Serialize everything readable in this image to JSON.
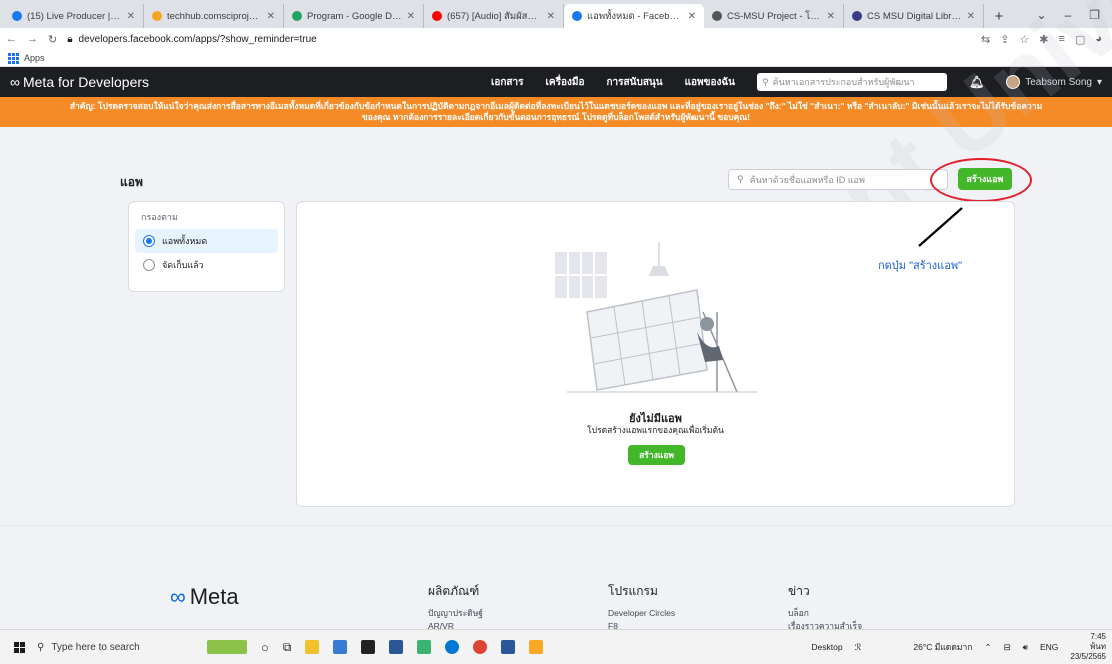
{
  "browser": {
    "tabs": [
      {
        "title": "(15) Live Producer | Facebook",
        "fav": "#1877f2",
        "active": false
      },
      {
        "title": "techhub.comsciproject.com / lo",
        "fav": "#f5a623",
        "active": false
      },
      {
        "title": "Program - Google Drive",
        "fav": "#1fa463",
        "active": false
      },
      {
        "title": "(657) [Audio] สัมผัสที่โลกสัมผ...",
        "fav": "#ff0000",
        "active": false
      },
      {
        "title": "แอพทั้งหมด - Facebook สำหรับผู้พั...",
        "fav": "#1877f2",
        "active": true
      },
      {
        "title": "CS-MSU Project - โปรเจ็คจบการศ...",
        "fav": "#555555",
        "active": false
      },
      {
        "title": "CS MSU Digital Library ระบบการจั...",
        "fav": "#3a3a8c",
        "active": false
      }
    ],
    "new_tab": "+",
    "url": "developers.facebook.com/apps/?show_reminder=true",
    "bookmarks_label": "Apps"
  },
  "header": {
    "brand": "Meta for Developers",
    "nav": [
      "เอกสาร",
      "เครื่องมือ",
      "การสนับสนุน",
      "แอพของฉัน"
    ],
    "search_placeholder": "ค้นหาเอกสารประกอบสำหรับผู้พัฒนา",
    "user_name": "Teabsom Song"
  },
  "banner": {
    "line1": "สำคัญ: โปรดตรวจสอบให้แน่ใจว่าคุณส่งการสื่อสารทางอีเมลทั้งหมดที่เกี่ยวข้องกับข้อกำหนดในการปฏิบัติตามกฎจากอีเมลผู้ติดต่อที่ลงทะเบียนไว้ในแดชบอร์ดของแอพ และที่อยู่ของเราอยู่ในช่อง \"ถึง:\" ไม่ใช่ \"สำเนา:\" หรือ \"สำเนาลับ:\" มิเช่นนั้นแล้วเราจะไม่ได้รับข้อความ",
    "line2": "ของคุณ หากต้องการรายละเอียดเกี่ยวกับขั้นตอนการอุทธรณ์ โปรดดูที่บล็อกโพสต์สำหรับผู้พัฒนานี้ ขอบคุณ!"
  },
  "main": {
    "title": "แอพ",
    "search_placeholder": "ค้นหาด้วยชื่อแอพหรือ ID แอพ",
    "create_button": "สร้างแอพ",
    "filter": {
      "label": "กรองตาม",
      "options": [
        {
          "label": "แอพทั้งหมด",
          "selected": true
        },
        {
          "label": "จัดเก็บแล้ว",
          "selected": false
        }
      ]
    },
    "empty": {
      "title": "ยังไม่มีแอพ",
      "subtitle": "โปรดสร้างแอพแรกของคุณเพื่อเริ่มต้น",
      "button": "สร้างแอพ"
    }
  },
  "annotation": {
    "text": "กดปุ่ม \"สร้างแอพ\"",
    "color": "#e41e2b"
  },
  "footer": {
    "logo": "Meta",
    "columns": [
      {
        "heading": "ผลิตภัณฑ์",
        "items": [
          "ปัญญาประดิษฐ์",
          "AR/VR"
        ]
      },
      {
        "heading": "โปรแกรม",
        "items": [
          "Developer Circles",
          "F8"
        ]
      },
      {
        "heading": "ข่าว",
        "items": [
          "บล็อก",
          "เรื่องราวความสำเร็จ"
        ]
      }
    ]
  },
  "watermark": "Department University",
  "taskbar": {
    "search_placeholder": "Type here to search",
    "desktop": "Desktop",
    "weather": "26°C มีแดดมาก",
    "lang": "ENG",
    "time": "7:45",
    "day": "พ้นท",
    "date": "23/5/2565"
  }
}
